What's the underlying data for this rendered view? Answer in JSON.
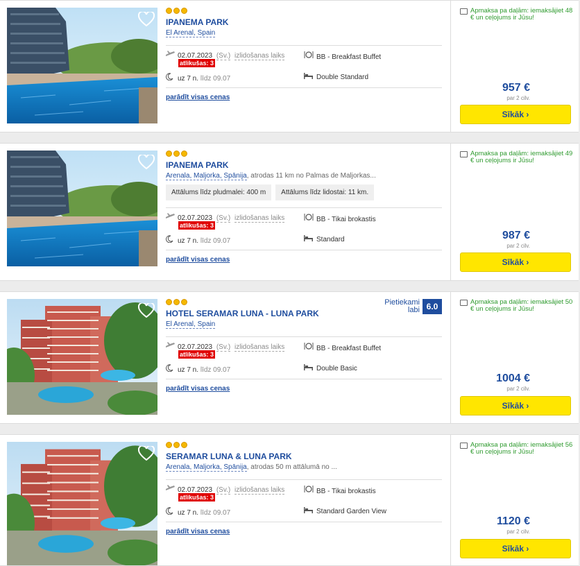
{
  "hotels": [
    {
      "stars": 3,
      "name": "IPANEMA PARK",
      "location": "El Arenal, Spain",
      "location_desc": "",
      "chips": [],
      "date": "02.07.2023",
      "day_label": "(Sv.)",
      "departure_label": "izlidošanas laiks",
      "left_label": "atlikušas: 3",
      "nights": "uz 7 n.",
      "until": "līdz 09.07",
      "board": "BB - Breakfast Buffet",
      "room": "Double Standard",
      "show_prices": "parādīt visas cenas",
      "rating_text": "",
      "rating_text2": "",
      "rating_score": "",
      "payment": "Apmaksa pa daļām: iemaksājiet 48 € un ceļojums ir Jūsu!",
      "price": "957 €",
      "per_persons": "par 2 cilv.",
      "button": "Sīkāk",
      "image": "pool"
    },
    {
      "stars": 3,
      "name": "IPANEMA PARK",
      "location": "Arenala, Maljorka, Spānija",
      "location_desc": ", atrodas 11 km no Palmas de Maljorkas...",
      "chips": [
        "Attālums līdz pludmalei: 400 m",
        "Attālums līdz lidostai: 11 km."
      ],
      "date": "02.07.2023",
      "day_label": "(Sv.)",
      "departure_label": "izlidošanas laiks",
      "left_label": "atlikušas: 3",
      "nights": "uz 7 n.",
      "until": "līdz 09.07",
      "board": "BB - Tikai brokastis",
      "room": "Standard",
      "show_prices": "parādīt visas cenas",
      "rating_text": "",
      "rating_text2": "",
      "rating_score": "",
      "payment": "Apmaksa pa daļām: iemaksājiet 49 € un ceļojums ir Jūsu!",
      "price": "987 €",
      "per_persons": "par 2 cilv.",
      "button": "Sīkāk",
      "image": "pool"
    },
    {
      "stars": 3,
      "name": "HOTEL SERAMAR LUNA - LUNA PARK",
      "location": "El Arenal, Spain",
      "location_desc": "",
      "chips": [],
      "date": "02.07.2023",
      "day_label": "(Sv.)",
      "departure_label": "izlidošanas laiks",
      "left_label": "atlikušas: 3",
      "nights": "uz 7 n.",
      "until": "līdz 09.07",
      "board": "BB - Breakfast Buffet",
      "room": "Double Basic",
      "show_prices": "parādīt visas cenas",
      "rating_text": "Pietiekami",
      "rating_text2": "labi",
      "rating_score": "6.0",
      "payment": "Apmaksa pa daļām: iemaksājiet 50 € un ceļojums ir Jūsu!",
      "price": "1004 €",
      "per_persons": "par 2 cilv.",
      "button": "Sīkāk",
      "image": "tower"
    },
    {
      "stars": 3,
      "name": "SERAMAR LUNA & LUNA PARK",
      "location": "Arenala, Maljorka, Spānija",
      "location_desc": ", atrodas 50 m attālumā no ...",
      "chips": [],
      "date": "02.07.2023",
      "day_label": "(Sv.)",
      "departure_label": "izlidošanas laiks",
      "left_label": "atlikušas: 3",
      "nights": "uz 7 n.",
      "until": "līdz 09.07",
      "board": "BB - Tikai brokastis",
      "room": "Standard Garden View",
      "show_prices": "parādīt visas cenas",
      "rating_text": "",
      "rating_text2": "",
      "rating_score": "",
      "payment": "Apmaksa pa daļām: iemaksājiet 56 € un ceļojums ir Jūsu!",
      "price": "1120 €",
      "per_persons": "par 2 cilv.",
      "button": "Sīkāk",
      "image": "tower"
    }
  ],
  "colors": {
    "accent": "#1f4d9e",
    "button": "#ffe600",
    "alert": "#e00000",
    "payment": "#2e9a2e"
  }
}
